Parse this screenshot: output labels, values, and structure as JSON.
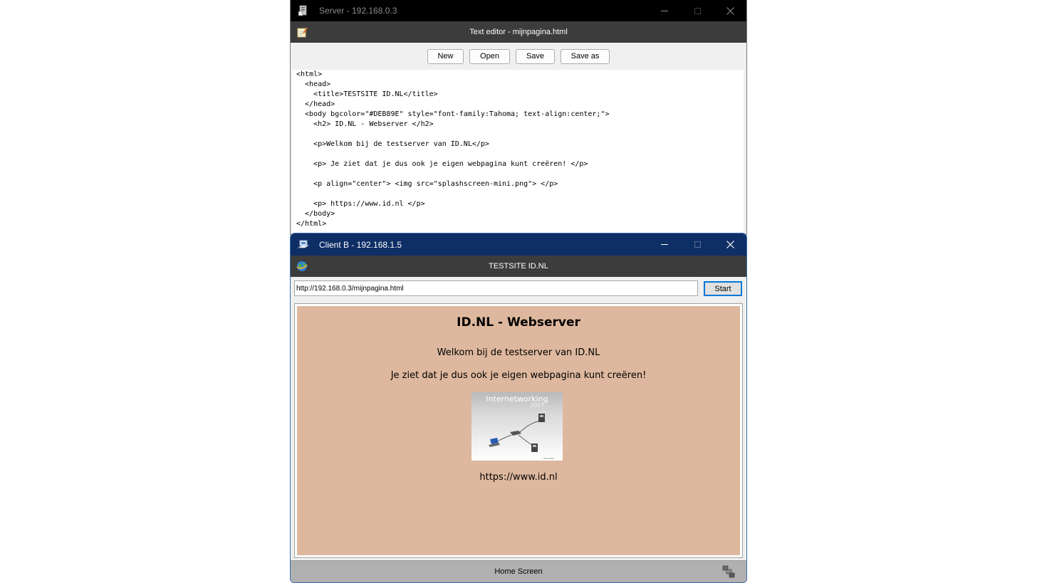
{
  "server_window": {
    "title": "Server - 192.168.0.3",
    "app_title": "Text editor - mijnpagina.html",
    "toolbar": {
      "new": "New",
      "open": "Open",
      "save": "Save",
      "save_as": "Save as"
    },
    "code": [
      "<html>",
      "  <head>",
      "    <title>TESTSITE ID.NL</title>",
      "  </head>",
      "  <body bgcolor=\"#DEB89E\" style=\"font-family:Tahoma; text-align:center;\">",
      "    <h2> ID.NL - Webserver </h2>",
      "",
      "    <p>Welkom bij de testserver van ID.NL</p>",
      "",
      "    <p> Je ziet dat je dus ook je eigen webpagina kunt creëren! </p>",
      "",
      "    <p align=\"center\"> <img src=\"splashscreen-mini.png\"> </p>",
      "",
      "    <p> https://www.id.nl </p>",
      "  </body>",
      "</html>"
    ]
  },
  "client_window": {
    "title": "Client B - 192.168.1.5",
    "app_title": "TESTSITE ID.NL",
    "url": "http://192.168.0.3/mijnpagina.html",
    "start_label": "Start",
    "page": {
      "heading": "ID.NL - Webserver",
      "p1": "Welkom bij de testserver van ID.NL",
      "p2": "Je ziet dat je dus ook je eigen webpagina kunt creëren!",
      "image_title": "Internetworking",
      "image_year": "2007",
      "p4": "https://www.id.nl",
      "background": "#DEB89E"
    },
    "status": "Home Screen"
  },
  "colors": {
    "server_titlebar": "#000000",
    "client_titlebar": "#0e2e66",
    "app_header": "#3c3c3c",
    "status_bar": "#b0b0b0"
  },
  "icons": {
    "server_title": "server-icon",
    "editor": "notepad-icon",
    "client_title": "network-icon",
    "browser": "globe-icon",
    "status": "windows-tile-icon"
  }
}
